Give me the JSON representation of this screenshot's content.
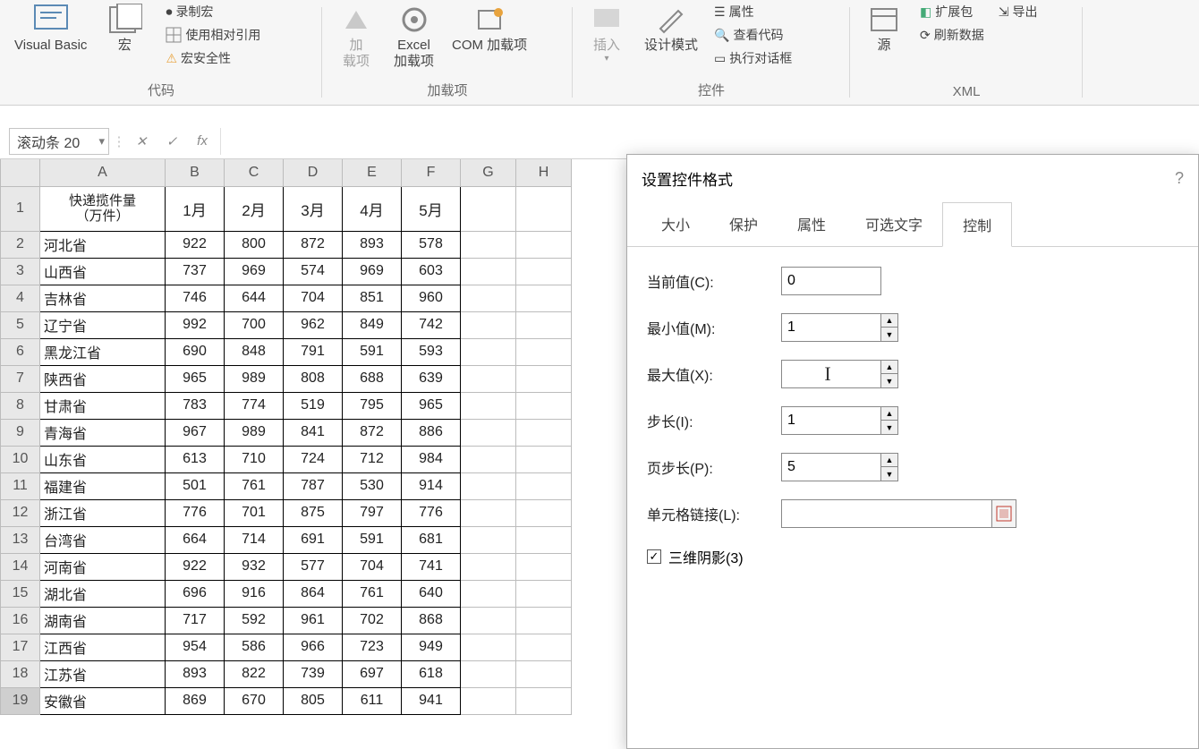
{
  "ribbon": {
    "groups": {
      "code": {
        "label": "代码",
        "visual_basic": "Visual Basic",
        "macros": "宏",
        "record": "录制宏",
        "use_relative": "使用相对引用",
        "macro_security": "宏安全性"
      },
      "addins": {
        "label": "加载项",
        "addins_btn": "加\n载项",
        "excel_addins": "Excel\n加载项",
        "com_addins": "COM 加载项"
      },
      "controls": {
        "label": "控件",
        "insert": "插入",
        "design_mode": "设计模式",
        "properties": "属性",
        "view_code": "查看代码",
        "run_dialog": "执行对话框"
      },
      "xml": {
        "label": "XML",
        "source": "源",
        "ext_pkg": "扩展包",
        "export": "导出",
        "refresh": "刷新数据"
      }
    }
  },
  "name_box": "滚动条 20",
  "formula_bar": {
    "cancel": "✕",
    "confirm": "✓",
    "fx": "fx"
  },
  "grid": {
    "columns": [
      "A",
      "B",
      "C",
      "D",
      "E",
      "F",
      "G",
      "H"
    ],
    "header_row": [
      "快递揽件量\n（万件）",
      "1月",
      "2月",
      "3月",
      "4月",
      "5月"
    ],
    "rows": [
      {
        "n": 1
      },
      {
        "n": 2,
        "p": "河北省",
        "v": [
          922,
          800,
          872,
          893,
          578
        ]
      },
      {
        "n": 3,
        "p": "山西省",
        "v": [
          737,
          969,
          574,
          969,
          603
        ]
      },
      {
        "n": 4,
        "p": "吉林省",
        "v": [
          746,
          644,
          704,
          851,
          960
        ]
      },
      {
        "n": 5,
        "p": "辽宁省",
        "v": [
          992,
          700,
          962,
          849,
          742
        ]
      },
      {
        "n": 6,
        "p": "黑龙江省",
        "v": [
          690,
          848,
          791,
          591,
          593
        ]
      },
      {
        "n": 7,
        "p": "陕西省",
        "v": [
          965,
          989,
          808,
          688,
          639
        ]
      },
      {
        "n": 8,
        "p": "甘肃省",
        "v": [
          783,
          774,
          519,
          795,
          965
        ]
      },
      {
        "n": 9,
        "p": "青海省",
        "v": [
          967,
          989,
          841,
          872,
          886
        ]
      },
      {
        "n": 10,
        "p": "山东省",
        "v": [
          613,
          710,
          724,
          712,
          984
        ]
      },
      {
        "n": 11,
        "p": "福建省",
        "v": [
          501,
          761,
          787,
          530,
          914
        ]
      },
      {
        "n": 12,
        "p": "浙江省",
        "v": [
          776,
          701,
          875,
          797,
          776
        ]
      },
      {
        "n": 13,
        "p": "台湾省",
        "v": [
          664,
          714,
          691,
          591,
          681
        ]
      },
      {
        "n": 14,
        "p": "河南省",
        "v": [
          922,
          932,
          577,
          704,
          741
        ]
      },
      {
        "n": 15,
        "p": "湖北省",
        "v": [
          696,
          916,
          864,
          761,
          640
        ]
      },
      {
        "n": 16,
        "p": "湖南省",
        "v": [
          717,
          592,
          961,
          702,
          868
        ]
      },
      {
        "n": 17,
        "p": "江西省",
        "v": [
          954,
          586,
          966,
          723,
          949
        ]
      },
      {
        "n": 18,
        "p": "江苏省",
        "v": [
          893,
          822,
          739,
          697,
          618
        ]
      },
      {
        "n": 19,
        "p": "安徽省",
        "v": [
          869,
          670,
          805,
          611,
          941
        ]
      }
    ],
    "current_row": 19
  },
  "dialog": {
    "title": "设置控件格式",
    "tabs": [
      "大小",
      "保护",
      "属性",
      "可选文字",
      "控制"
    ],
    "active_tab": 4,
    "fields": {
      "current_value": {
        "label": "当前值(C):",
        "value": "0"
      },
      "min_value": {
        "label": "最小值(M):",
        "value": "1"
      },
      "max_value": {
        "label": "最大值(X):",
        "value": ""
      },
      "step": {
        "label": "步长(I):",
        "value": "1"
      },
      "page_step": {
        "label": "页步长(P):",
        "value": "5"
      },
      "cell_link": {
        "label": "单元格链接(L):"
      }
    },
    "shadow_3d": {
      "label": "三维阴影(3)",
      "checked": true
    }
  }
}
